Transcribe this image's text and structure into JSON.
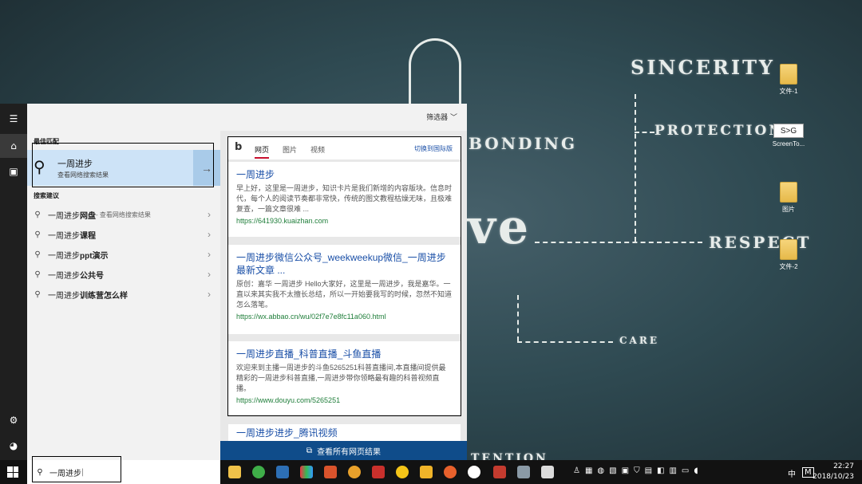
{
  "wallpaper": {
    "words": [
      "SINCERITY",
      "PROTECTION",
      "BONDING",
      "RESPECT",
      "CARE",
      "ve",
      "TENTION"
    ]
  },
  "desktop_icons": [
    {
      "label": "文件-1",
      "icon": "folder-icon"
    },
    {
      "label": "ScreenTo...",
      "icon": "app-icon",
      "glyph": "S>G"
    },
    {
      "label": "图片",
      "icon": "folder-icon"
    },
    {
      "label": "文件-2",
      "icon": "folder-icon"
    }
  ],
  "start": {
    "rail_icons": [
      "menu-icon",
      "home-icon",
      "notebook-icon",
      "settings-icon",
      "user-icon",
      "windows-logo-icon"
    ],
    "toolbar": {
      "filter_label": "筛选器",
      "icons": [
        "document-icon",
        "file-icon",
        "globe-icon"
      ]
    },
    "best_match": {
      "section": "最佳匹配",
      "title": "一周进步",
      "subtitle": "查看网络搜索结果"
    },
    "suggestions": {
      "section": "搜索建议",
      "items": [
        {
          "prefix": "一周进步",
          "bold": "网盘",
          "suffix": " - 查看网络搜索结果"
        },
        {
          "prefix": "一周进步",
          "bold": "课程",
          "suffix": ""
        },
        {
          "prefix": "一周进步",
          "bold": "ppt演示",
          "suffix": ""
        },
        {
          "prefix": "一周进步",
          "bold": "公共号",
          "suffix": ""
        },
        {
          "prefix": "一周进步",
          "bold": "训练营怎么样",
          "suffix": ""
        }
      ]
    }
  },
  "preview": {
    "tabs": [
      "网页",
      "图片",
      "视频"
    ],
    "switch_label": "切换到国际版",
    "results": [
      {
        "title": "一周进步",
        "snippet": "早上好，这里是一周进步，知识卡片是我们新增的内容版块。信息时代，每个人的阅读节奏都非常快，传统的图文教程枯燥无味，且极难复查，一篇文章很难 ...",
        "url": "https://641930.kuaizhan.com"
      },
      {
        "title": "一周进步微信公众号_weekweekup微信_一周进步最新文章 ...",
        "snippet": "原创：嘉华 一周进步 Hello大家好，这里是一周进步，我是嘉华。一直以来其实我不太擅长总结，所以一开始要我写的时候，忽然不知道怎么落笔。",
        "url": "https://wx.abbao.cn/wu/02f7e7e8fc11a060.html"
      },
      {
        "title": "一周进步直播_科普直播_斗鱼直播",
        "snippet": "欢迎来到主播一周进步的斗鱼5265251科普直播间,本直播间提供最精彩的一周进步科普直播,一周进步带你领略最有趣的科普视频直播。",
        "url": "https://www.douyu.com/5265251"
      },
      {
        "title": "一周进步进步_腾讯视频",
        "snippet": "",
        "url": ""
      }
    ],
    "all_results": "查看所有网页结果"
  },
  "taskbar": {
    "search_value": "一周进步",
    "time": "22:27",
    "date": "2018/10/23",
    "ime": "中",
    "ime2": "M"
  }
}
